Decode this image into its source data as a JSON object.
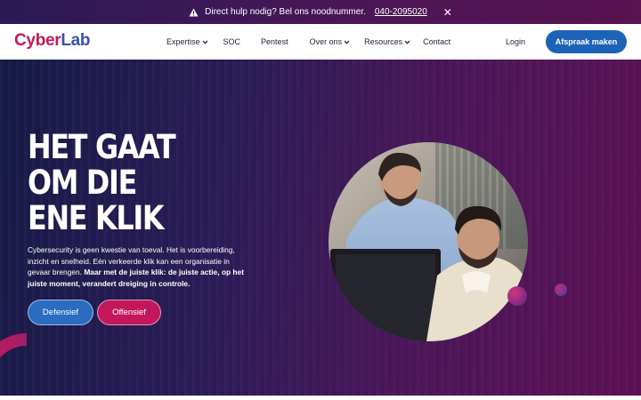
{
  "alert": {
    "message": "Direct hulp nodig? Bel ons noodnummer.",
    "phone": "040-2095020",
    "close_symbol": "✕"
  },
  "header": {
    "logo_part1": "Cyber",
    "logo_part2": "Lab",
    "nav": [
      {
        "label": "Expertise",
        "dropdown": true
      },
      {
        "label": "SOC",
        "dropdown": false
      },
      {
        "label": "Pentest",
        "dropdown": false
      },
      {
        "label": "Over ons",
        "dropdown": true
      },
      {
        "label": "Resources",
        "dropdown": true
      },
      {
        "label": "Contact",
        "dropdown": false
      }
    ],
    "login": "Login",
    "cta": "Afspraak maken"
  },
  "hero": {
    "title_lines": [
      "HET GAAT",
      "OM DIE",
      "ENE KLIK"
    ],
    "text_regular": "Cybersecurity is geen kwestie van toeval. Het is voorbereiding, inzicht en snelheid. Eén verkeerde klik kan een organisatie in gevaar brengen.",
    "text_bold": "Maar met de juiste klik: de juiste actie, op het juiste moment, verandert dreiging in controle.",
    "btn_defensief": "Defensief",
    "btn_offensief": "Offensief"
  },
  "colors": {
    "brand_pink": "#c2185b",
    "brand_blue": "#1c63b7",
    "hero_dark": "#161a46",
    "hero_purple": "#5c1052"
  },
  "icons": [
    "warning-icon",
    "close-icon",
    "chevron-down-icon"
  ]
}
